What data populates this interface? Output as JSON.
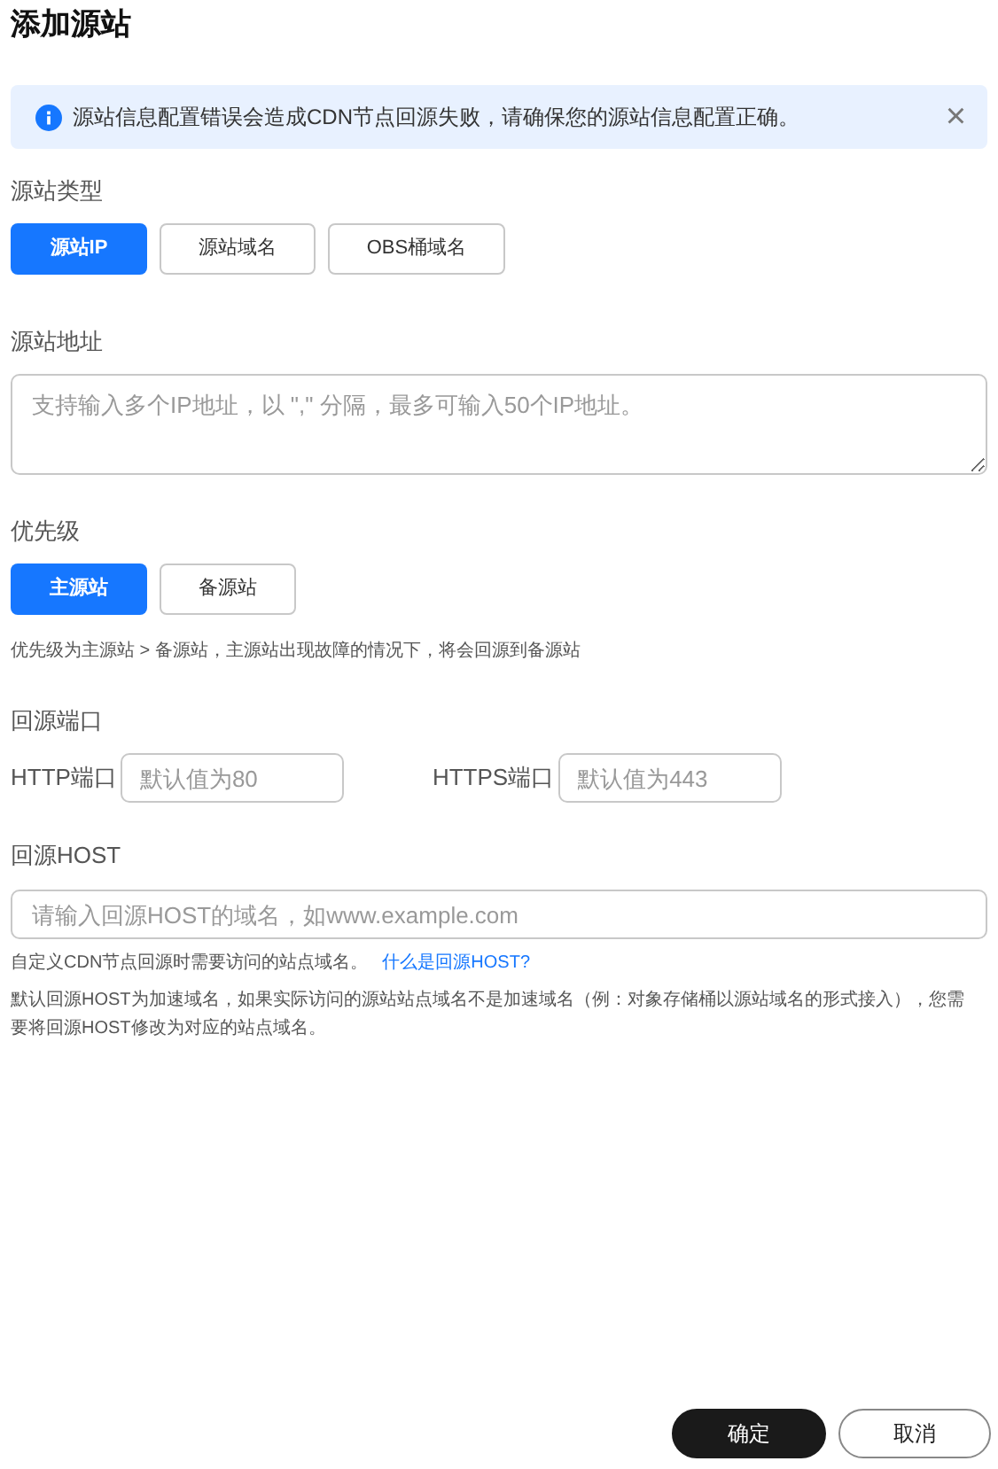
{
  "title": "添加源站",
  "alert": {
    "text": "源站信息配置错误会造成CDN节点回源失败，请确保您的源站信息配置正确。",
    "close": "×"
  },
  "origin_type": {
    "label": "源站类型",
    "options": [
      {
        "label": "源站IP",
        "selected": true
      },
      {
        "label": "源站域名",
        "selected": false
      },
      {
        "label": "OBS桶域名",
        "selected": false
      }
    ]
  },
  "origin_address": {
    "label": "源站地址",
    "placeholder": "支持输入多个IP地址，以 \",\" 分隔，最多可输入50个IP地址。"
  },
  "priority": {
    "label": "优先级",
    "options": [
      {
        "label": "主源站",
        "selected": true
      },
      {
        "label": "备源站",
        "selected": false
      }
    ],
    "hint": "优先级为主源站 > 备源站，主源站出现故障的情况下，将会回源到备源站"
  },
  "origin_port": {
    "label": "回源端口",
    "fields": [
      {
        "label": "HTTP端口",
        "placeholder": "默认值为80"
      },
      {
        "label": "HTTPS端口",
        "placeholder": "默认值为443"
      }
    ]
  },
  "origin_host": {
    "label": "回源HOST",
    "placeholder": "请输入回源HOST的域名，如www.example.com",
    "help": "自定义CDN节点回源时需要访问的站点域名。",
    "help_link": "什么是回源HOST?",
    "note": "默认回源HOST为加速域名，如果实际访问的源站站点域名不是加速域名（例：对象存储桶以源站域名的形式接入），您需要将回源HOST修改为对应的站点域名。"
  },
  "buttons": [
    {
      "label": "确定",
      "kind": "primary"
    },
    {
      "label": "取消",
      "kind": "secondary"
    }
  ]
}
